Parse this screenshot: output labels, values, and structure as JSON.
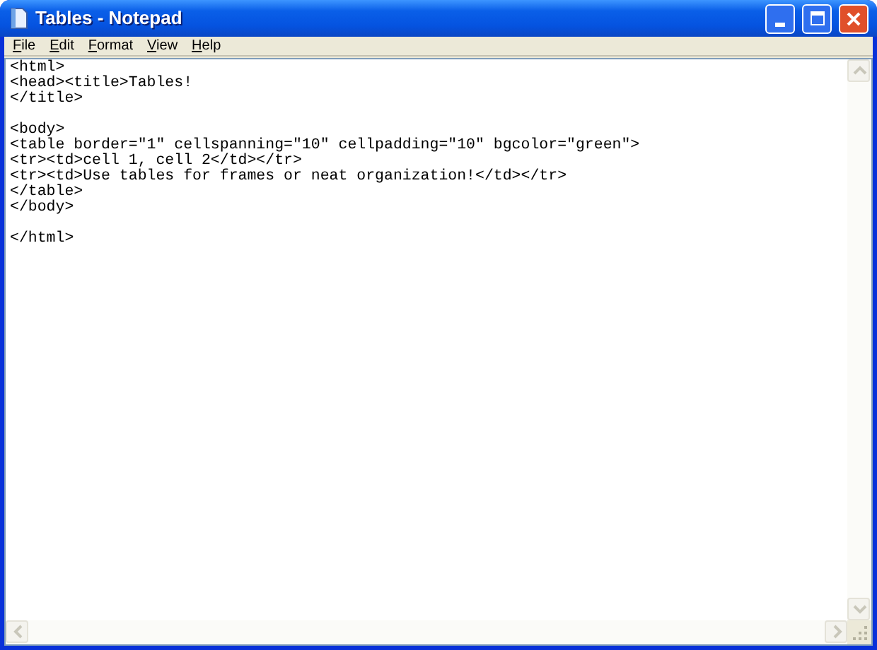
{
  "window": {
    "title": "Tables - Notepad"
  },
  "menu": [
    {
      "label": "File"
    },
    {
      "label": "Edit"
    },
    {
      "label": "Format"
    },
    {
      "label": "View"
    },
    {
      "label": "Help"
    }
  ],
  "document": {
    "text": "<html>\n<head><title>Tables!\n</title>\n\n<body>\n<table border=\"1\" cellspanning=\"10\" cellpadding=\"10\" bgcolor=\"green\">\n<tr><td>cell 1, cell 2</td></tr>\n<tr><td>Use tables for frames or neat organization!</td></tr>\n</table>\n</body>\n\n</html>"
  }
}
